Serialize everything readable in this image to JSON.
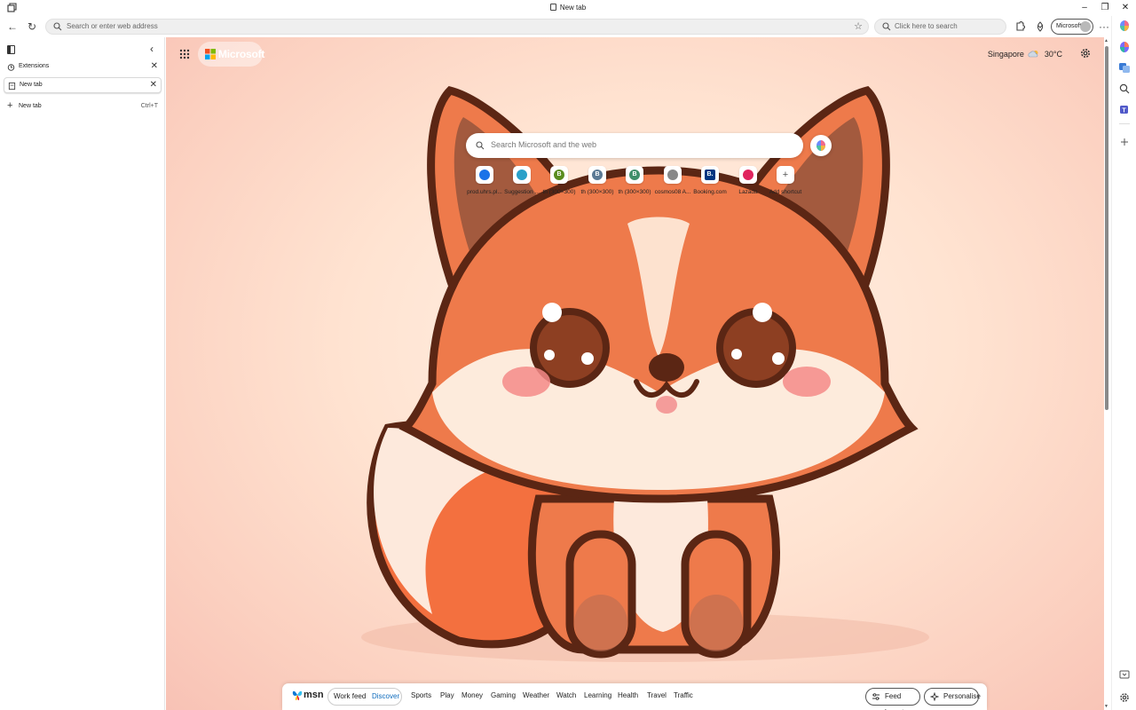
{
  "window": {
    "tab_title": "New tab",
    "minimize": "–",
    "restore": "❐",
    "close": "✕"
  },
  "toolbar": {
    "address_placeholder": "Search or enter web address",
    "side_search_placeholder": "Click here to search",
    "profile_label": "Microsoft"
  },
  "vertical_tabs": {
    "tabs": [
      {
        "label": "Extensions",
        "icon": "extensions-icon"
      },
      {
        "label": "New tab",
        "icon": "document-icon",
        "active": true
      }
    ],
    "new_tab_label": "New tab",
    "new_tab_shortcut": "Ctrl+T"
  },
  "newtab_page": {
    "brand": "Microsoft",
    "weather": {
      "location": "Singapore",
      "temperature": "30°C",
      "icon": "cloud-icon"
    },
    "search_placeholder": "Search Microsoft and the web",
    "quick_links": [
      {
        "label": "prod.uhrs.pl...",
        "letter": "",
        "color": "#1a73e8"
      },
      {
        "label": "Suggestion ...",
        "letter": "",
        "color": "#2aa0c9"
      },
      {
        "label": "th (300×300)",
        "letter": "B",
        "color": "#5a8c1e"
      },
      {
        "label": "th (300×300)",
        "letter": "B",
        "color": "#5b7a95"
      },
      {
        "label": "th (300×300)",
        "letter": "B",
        "color": "#3f8f6a"
      },
      {
        "label": "cosmos08 A...",
        "letter": "",
        "color": "#888888"
      },
      {
        "label": "Booking.com",
        "letter": "B.",
        "color": "#003580"
      },
      {
        "label": "Lazada",
        "letter": "",
        "color": "#e0245e"
      },
      {
        "label": "Add shortcut",
        "letter": "+",
        "color": "#666666"
      }
    ]
  },
  "feed": {
    "brand": "msn",
    "segments": [
      "Work feed",
      "Discover"
    ],
    "active_segment": "Discover",
    "nav": [
      "Sports",
      "Play",
      "Money",
      "Gaming",
      "Weather",
      "Watch",
      "Learning",
      "Health",
      "Travel",
      "Traffic"
    ],
    "feed_layout": "Feed layout",
    "personalise": "Personalise"
  },
  "colors": {
    "accent": "#0f6cbd",
    "background": "#fde2d2"
  }
}
